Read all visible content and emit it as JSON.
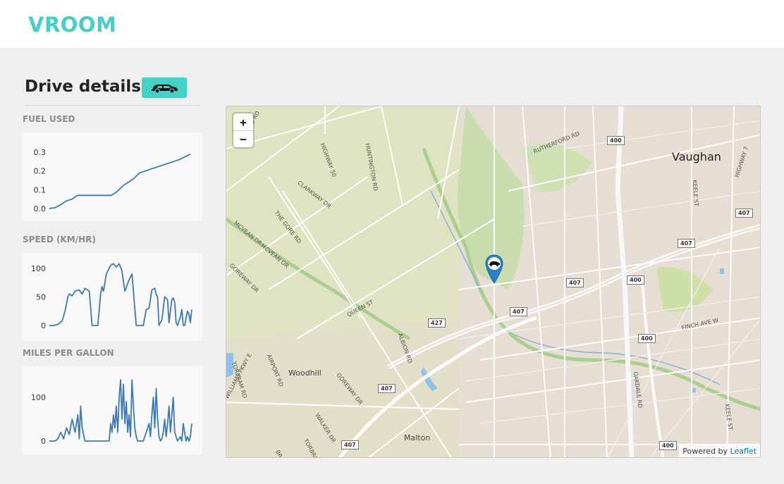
{
  "app": {
    "brand": "VROOM"
  },
  "page": {
    "title": "Drive details"
  },
  "icons": {
    "vehicle": "car-icon",
    "marker": "map-marker-icon",
    "zoom_in": "plus-icon",
    "zoom_out": "minus-icon"
  },
  "colors": {
    "brand": "#43d1c6",
    "line": "#3d7ab5",
    "marker": "#2a81cb"
  },
  "charts": {
    "fuel": {
      "label": "FUEL USED"
    },
    "speed": {
      "label": "SPEED (KM/HR)"
    },
    "mpg": {
      "label": "MILES PER GALLON"
    }
  },
  "chart_data": [
    {
      "type": "line",
      "label": "FUEL USED",
      "x": [
        0,
        4,
        8,
        12,
        16,
        20,
        24,
        28,
        32,
        36,
        40,
        44,
        48,
        52,
        56,
        60,
        64,
        68,
        72,
        76,
        80,
        84,
        88,
        92,
        96,
        100
      ],
      "values": [
        0.0,
        0.005,
        0.02,
        0.04,
        0.05,
        0.07,
        0.07,
        0.07,
        0.07,
        0.07,
        0.07,
        0.07,
        0.09,
        0.12,
        0.14,
        0.16,
        0.19,
        0.2,
        0.21,
        0.22,
        0.23,
        0.24,
        0.25,
        0.26,
        0.275,
        0.29
      ],
      "yticks": [
        0.0,
        0.1,
        0.2,
        0.3
      ],
      "ylim": [
        0,
        0.3
      ]
    },
    {
      "type": "line",
      "label": "SPEED (KM/HR)",
      "x": [
        0,
        1.5,
        3,
        6,
        9,
        11,
        13,
        14,
        16,
        18,
        21,
        23,
        25,
        28,
        30,
        32,
        34,
        36,
        37,
        38,
        40,
        43,
        45,
        47,
        49,
        51,
        53,
        56,
        58,
        59,
        60,
        61,
        63,
        66,
        68,
        70,
        72,
        74,
        75,
        76,
        77,
        79,
        81,
        83,
        84,
        86,
        87,
        88,
        89,
        90,
        92,
        93,
        94,
        95,
        97,
        98,
        99,
        100
      ],
      "values": [
        0,
        0,
        0,
        2,
        8,
        25,
        50,
        55,
        52,
        60,
        62,
        55,
        65,
        60,
        0,
        0,
        0,
        55,
        68,
        60,
        90,
        105,
        108,
        102,
        108,
        95,
        60,
        80,
        90,
        60,
        30,
        0,
        0,
        0,
        28,
        30,
        62,
        65,
        55,
        50,
        0,
        10,
        50,
        45,
        5,
        45,
        48,
        40,
        5,
        0,
        15,
        28,
        0,
        0,
        25,
        20,
        5,
        28
      ],
      "yticks": [
        0,
        50,
        100
      ],
      "ylim": [
        0,
        112
      ]
    },
    {
      "type": "line",
      "label": "MILES PER GALLON",
      "x": [
        0,
        2,
        4,
        6,
        8,
        10,
        12,
        14,
        16,
        18,
        19,
        20,
        21,
        22,
        23,
        25,
        27,
        29,
        31,
        33,
        35,
        37,
        39,
        42,
        43,
        44,
        45,
        46,
        47,
        48,
        49,
        50,
        51,
        52,
        53,
        54,
        55,
        56,
        57,
        58,
        59,
        60,
        61,
        62,
        63,
        64,
        66,
        68,
        70,
        71,
        72,
        73,
        74,
        75,
        76,
        77,
        78,
        79,
        80,
        81,
        82,
        83,
        84,
        85,
        86,
        87,
        88,
        89,
        90,
        91,
        92,
        93,
        94,
        95,
        96,
        97,
        98,
        99,
        100
      ],
      "values": [
        0,
        0,
        0,
        5,
        20,
        5,
        30,
        15,
        50,
        20,
        40,
        60,
        5,
        80,
        30,
        0,
        0,
        0,
        0,
        0,
        0,
        0,
        0,
        0,
        40,
        20,
        60,
        30,
        80,
        20,
        100,
        140,
        50,
        130,
        40,
        90,
        20,
        60,
        10,
        140,
        80,
        30,
        10,
        0,
        0,
        0,
        0,
        20,
        40,
        10,
        60,
        100,
        30,
        120,
        50,
        10,
        0,
        5,
        20,
        50,
        10,
        40,
        80,
        20,
        60,
        100,
        20,
        10,
        0,
        5,
        10,
        0,
        40,
        20,
        0,
        10,
        0,
        10,
        40
      ],
      "yticks": [
        0,
        100
      ],
      "ylim": [
        0,
        150
      ]
    }
  ],
  "map": {
    "zoom_in": "+",
    "zoom_out": "−",
    "attribution_prefix": "Powered by",
    "attribution_link": "Leaflet",
    "places": {
      "vaughan": "Vaughan",
      "woodhill": "Woodhill",
      "malton": "Malton"
    },
    "roads": {
      "mayfield": "MAYFIELD RD",
      "highway50": "HIGHWAY 50",
      "huntington": "HUNTINGTON RD",
      "clarkway": "CLARKWAY DR",
      "thegore": "THE GORE RD",
      "mcvean1": "MCVEAN DR",
      "mcvean2": "MCVEAN DR",
      "goreway1": "GOREWAY DR",
      "goreway2": "GOREWAY DR",
      "queen": "QUEEN ST",
      "albion": "ALBION RD",
      "airport": "AIRPORT RD",
      "torbram1": "TORBRAM RD",
      "torbram2": "TORBRAM RD",
      "williams": "WILLIAMS PKWY E",
      "walker": "WALKER DR",
      "rutherford": "RUTHERFORD RD",
      "keele1": "KEELE ST",
      "keele2": "KEELE ST",
      "highway7": "HIGHWAY 7",
      "finch": "FINCH AVE W",
      "oakdale": "OAKDALE RD",
      "bramalea": "BRAM"
    },
    "shields": {
      "s400a": "400",
      "s400b": "400",
      "s400c": "400",
      "s400d": "400",
      "s407a": "407",
      "s407b": "407",
      "s407c": "407",
      "s407d": "407",
      "s407e": "407",
      "s407f": "407",
      "s427": "427"
    }
  }
}
